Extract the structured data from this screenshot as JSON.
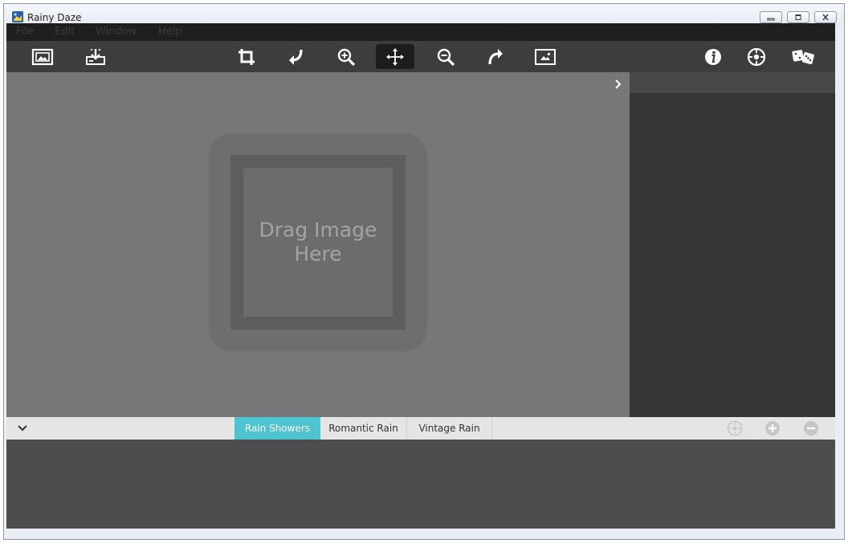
{
  "window": {
    "title": "Rainy Daze",
    "controls": [
      "minimize-icon",
      "maximize-icon",
      "close-icon"
    ]
  },
  "menu": {
    "items": [
      {
        "label": "File"
      },
      {
        "label": "Edit"
      },
      {
        "label": "Window"
      },
      {
        "label": "Help"
      }
    ]
  },
  "toolbar": {
    "icons": [
      "open-image-icon",
      "save-icon",
      "crop-icon",
      "undo-icon",
      "zoom-in-icon",
      "move-icon",
      "zoom-out-icon",
      "redo-icon",
      "fit-image-icon",
      "info-icon",
      "settings-icon",
      "randomize-dice-icon"
    ],
    "active_tool": "move-icon"
  },
  "canvas": {
    "drop_text": "Drag Image Here"
  },
  "tabs": {
    "items": [
      {
        "label": "Rain Showers",
        "active": true
      },
      {
        "label": "Romantic Rain",
        "active": false
      },
      {
        "label": "Vintage Rain",
        "active": false
      }
    ],
    "actions": [
      "preset-options-icon",
      "add-preset-icon",
      "remove-preset-icon"
    ]
  },
  "colors": {
    "accent": "#4ec4d0",
    "toolbar_bg": "#3d3d3d",
    "canvas_bg": "#777777",
    "panel_bg": "#353535"
  }
}
